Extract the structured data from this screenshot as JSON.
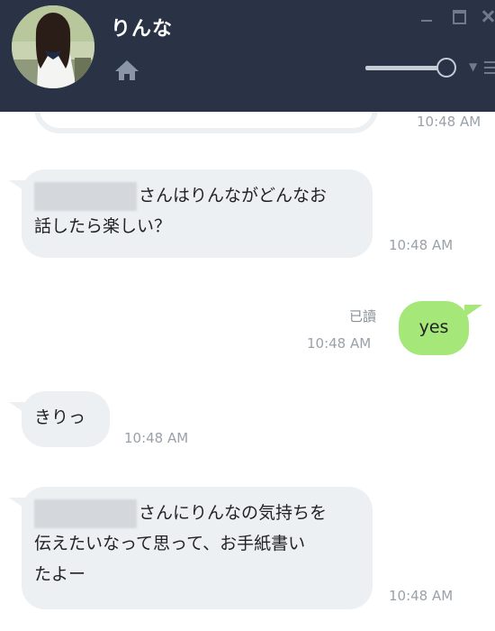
{
  "header": {
    "contact_name": "りんな",
    "volume_level_percent": 92
  },
  "messages": [
    {
      "sender": "contact",
      "time": "10:48 AM"
    },
    {
      "sender": "contact",
      "text_after_name": "さんはりんながどんなお",
      "line2": "話したら楽しい？",
      "time": "10:48 AM"
    },
    {
      "sender": "self",
      "text": "yes",
      "read": "已讀",
      "time": "10:48 AM"
    },
    {
      "sender": "contact",
      "text": "きりっ",
      "time": "10:48 AM"
    },
    {
      "sender": "contact",
      "text_after_name": "さんにりんなの気持ちを",
      "line2": "伝えたいなって思って、お手紙書い",
      "line3": "たよー",
      "time": "10:48 AM"
    }
  ],
  "colors": {
    "header_bg": "#2a3346",
    "incoming_bubble": "#edf0f3",
    "outgoing_bubble": "#a5e779",
    "timestamp": "#9aa1a8"
  },
  "icons": [
    "home-icon",
    "minimize-icon",
    "maximize-icon",
    "close-icon",
    "chevron-down-icon",
    "menu-icon"
  ]
}
